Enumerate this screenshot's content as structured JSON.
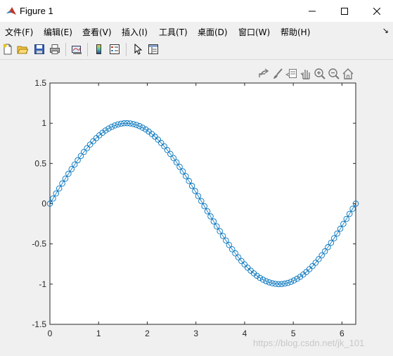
{
  "window": {
    "title": "Figure 1"
  },
  "menu": [
    "文件(F)",
    "编辑(E)",
    "查看(V)",
    "插入(I)",
    "工具(T)",
    "桌面(D)",
    "窗口(W)",
    "帮助(H)"
  ],
  "watermark": "https://blog.csdn.net/jk_101",
  "chart_data": {
    "type": "line",
    "marker": "o",
    "color": "#0072bd",
    "title": "",
    "xlabel": "",
    "ylabel": "",
    "xlim": [
      0,
      6.2832
    ],
    "ylim": [
      -1.5,
      1.5
    ],
    "xticks": [
      "0",
      "1",
      "2",
      "3",
      "4",
      "5",
      "6"
    ],
    "yticks": [
      "1.5",
      "1",
      "0.5",
      "0",
      "-0.5",
      "-1",
      "-1.5"
    ],
    "x": [
      0,
      0.0635,
      0.1269,
      0.1904,
      0.2539,
      0.3173,
      0.3808,
      0.4443,
      0.5077,
      0.5712,
      0.6347,
      0.6981,
      0.7616,
      0.8251,
      0.8885,
      0.952,
      1.0155,
      1.0789,
      1.1424,
      1.2059,
      1.2693,
      1.3328,
      1.3963,
      1.4597,
      1.5232,
      1.5867,
      1.6501,
      1.7136,
      1.7771,
      1.8405,
      1.904,
      1.9675,
      2.0309,
      2.0944,
      2.1579,
      2.2213,
      2.2848,
      2.3483,
      2.4117,
      2.4752,
      2.5387,
      2.6021,
      2.6656,
      2.7291,
      2.7925,
      2.856,
      2.9195,
      2.9829,
      3.0464,
      3.1099,
      3.1733,
      3.2368,
      3.3003,
      3.3637,
      3.4272,
      3.4907,
      3.5541,
      3.6176,
      3.6811,
      3.7445,
      3.808,
      3.8715,
      3.9349,
      3.9984,
      4.0619,
      4.1253,
      4.1888,
      4.2523,
      4.3157,
      4.3792,
      4.4427,
      4.5061,
      4.5696,
      4.6331,
      4.6965,
      4.76,
      4.8235,
      4.8869,
      4.9504,
      5.0139,
      5.0773,
      5.1408,
      5.2043,
      5.2677,
      5.3312,
      5.3947,
      5.4581,
      5.5216,
      5.5851,
      5.6485,
      5.712,
      5.7755,
      5.8389,
      5.9024,
      5.9659,
      6.0293,
      6.0928,
      6.1563,
      6.2197,
      6.2832
    ],
    "y": [
      0,
      0.0634,
      0.1266,
      0.1893,
      0.2511,
      0.312,
      0.3717,
      0.4298,
      0.4862,
      0.5406,
      0.5929,
      0.6428,
      0.6901,
      0.7346,
      0.7761,
      0.8146,
      0.8497,
      0.8815,
      0.9096,
      0.9341,
      0.9549,
      0.9718,
      0.9848,
      0.9938,
      0.9989,
      0.9999,
      0.9969,
      0.9898,
      0.9788,
      0.9638,
      0.945,
      0.9224,
      0.896,
      0.866,
      0.8326,
      0.7958,
      0.7557,
      0.7127,
      0.6668,
      0.6182,
      0.5671,
      0.5137,
      0.4582,
      0.4009,
      0.342,
      0.2817,
      0.2203,
      0.158,
      0.0951,
      0.0317,
      -0.0317,
      -0.0951,
      -0.158,
      -0.2203,
      -0.2817,
      -0.342,
      -0.4009,
      -0.4582,
      -0.5137,
      -0.5671,
      -0.6182,
      -0.6668,
      -0.7127,
      -0.7557,
      -0.7958,
      -0.8326,
      -0.866,
      -0.896,
      -0.9224,
      -0.945,
      -0.9638,
      -0.9788,
      -0.9898,
      -0.9969,
      -0.9999,
      -0.9989,
      -0.9938,
      -0.9848,
      -0.9718,
      -0.9549,
      -0.9341,
      -0.9096,
      -0.8815,
      -0.8497,
      -0.8146,
      -0.7761,
      -0.7346,
      -0.6901,
      -0.6428,
      -0.5929,
      -0.5406,
      -0.4862,
      -0.4298,
      -0.3717,
      -0.312,
      -0.2511,
      -0.1893,
      -0.1266,
      -0.0634,
      0
    ]
  }
}
